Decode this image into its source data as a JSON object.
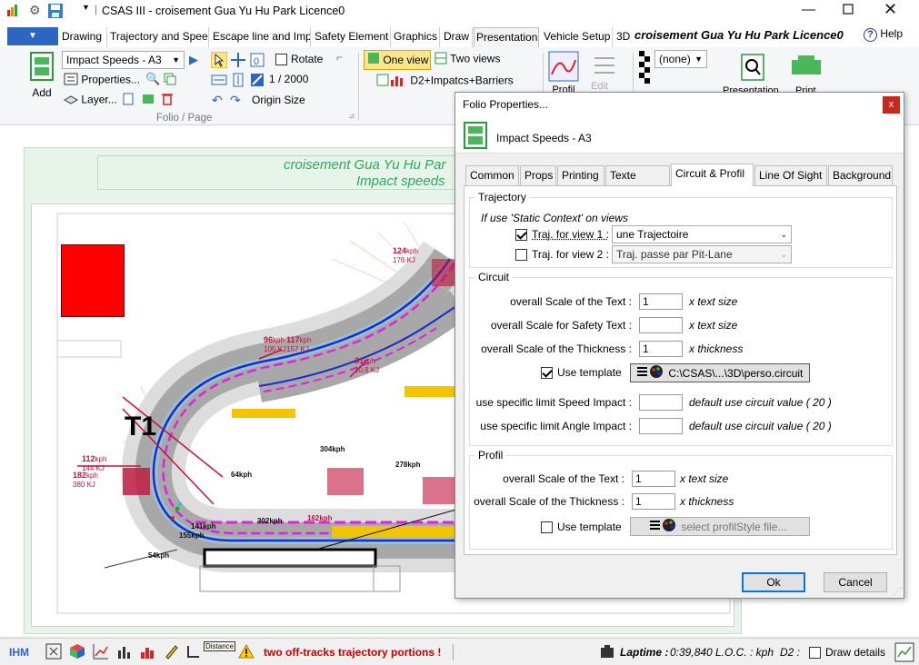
{
  "window": {
    "title": "CSAS III - croisement Gua Yu Hu Park Licence0"
  },
  "menu_tabs": [
    "Drawing",
    "Trajectory and Spee",
    "Escape line and Imp",
    "Safety Element",
    "Graphics",
    "Draw",
    "Presentation",
    "Vehicle Setup",
    "3D"
  ],
  "active_tab": "Presentation",
  "ribbon_title": "croisement Gua Yu Hu Park Licence0",
  "help_label": "Help",
  "ribbon": {
    "add_label": "Add",
    "folio_combo": "Impact Speeds - A3",
    "properties_label": "Properties...",
    "layers_label": "Layer...",
    "rotate_label": "Rotate",
    "scale_text": "1 /  2000",
    "origin_size_label": "Origin Size",
    "group_label": "Folio / Page",
    "one_view_label": "One view",
    "two_views_label": "Two views",
    "view_item_label": "D2+Impatcs+Barriers",
    "profil_label": "Profil",
    "edit_label": "Edit",
    "none_combo": "(none)",
    "presentation_label": "Presentation",
    "print_label": "Print"
  },
  "canvas": {
    "header_line1": "croisement Gua Yu Hu Par",
    "header_line2": "Impact speeds",
    "turn_label": "T1",
    "speeds": [
      {
        "kph": "124",
        "kj": "176 KJ"
      },
      {
        "kph": "96",
        "kj": "105 KJ"
      },
      {
        "kph": "117",
        "kj": "157 KJ"
      },
      {
        "kph": "31",
        "kj": "10,8 KJ"
      },
      {
        "kph": "112",
        "kj": "144 KJ"
      },
      {
        "kph": "182",
        "kj": "380 KJ"
      }
    ],
    "speed_unit": "kph",
    "track_speeds": [
      "304kph",
      "64kph",
      "278kph",
      "141kph",
      "155kph",
      "302kph",
      "162kph",
      "54kph"
    ]
  },
  "dialog": {
    "title": "Folio Properties...",
    "close_label": "x",
    "subtitle": "Impact Speeds - A3",
    "tabs": [
      "Common",
      "Props",
      "Printing",
      "Texte areas",
      "Circuit & Profil",
      "Line Of Sight",
      "Background"
    ],
    "active_tab": "Circuit & Profil",
    "trajectory": {
      "group_label": "Trajectory",
      "note": "If use 'Static Context' on views",
      "view1_label": "Traj. for view 1 :",
      "view1_checked": true,
      "view1_value": "une Trajectoire",
      "view2_label": "Traj. for view 2 :",
      "view2_checked": false,
      "view2_value": "Traj. passe par Pit-Lane"
    },
    "circuit": {
      "group_label": "Circuit",
      "scale_text_label": "overall Scale of the Text :",
      "scale_text_value": "1",
      "scale_text_unit": "x text size",
      "scale_safety_label": "overall Scale for Safety Text :",
      "scale_safety_value": "",
      "scale_safety_unit": "x text size",
      "scale_thickness_label": "overall Scale of the Thickness :",
      "scale_thickness_value": "1",
      "scale_thickness_unit": "x thickness",
      "use_template_label": "Use template",
      "use_template_checked": true,
      "template_path": "C:\\CSAS\\...\\3D\\perso.circuit",
      "limit_speed_label": "use specific limit Speed Impact :",
      "limit_speed_value": "",
      "limit_speed_hint": "default use circuit value ( 20 )",
      "limit_angle_label": "use specific limit Angle Impact :",
      "limit_angle_value": "",
      "limit_angle_hint": "default use circuit value ( 20 )"
    },
    "profil": {
      "group_label": "Profil",
      "scale_text_label": "overall Scale of the Text :",
      "scale_text_value": "1",
      "scale_text_unit": "x text size",
      "scale_thickness_label": "overall Scale of the Thickness :",
      "scale_thickness_value": "1",
      "scale_thickness_unit": "x thickness",
      "use_template_label": "Use template",
      "use_template_checked": false,
      "template_placeholder": "select profilStyle file..."
    },
    "ok_label": "Ok",
    "cancel_label": "Cancel"
  },
  "status": {
    "ihm_label": "IHM",
    "distance_label": "Distance",
    "warning": "two off-tracks trajectory portions !",
    "laptime_label": "Laptime :",
    "laptime_value": "0:39,840",
    "loc_text": "L.O.C. : kph",
    "d2_label": "D2 :",
    "draw_details_label": "Draw details"
  }
}
